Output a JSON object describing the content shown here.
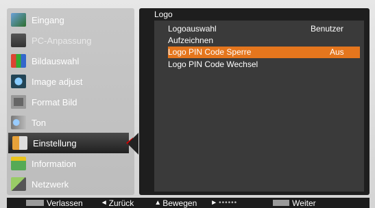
{
  "menu": {
    "items": [
      {
        "label": "Eingang",
        "icon": "input-icon",
        "disabled": false
      },
      {
        "label": "PC-Anpassung",
        "icon": "pc-adjust-icon",
        "disabled": true
      },
      {
        "label": "Bildauswahl",
        "icon": "image-select-icon",
        "disabled": false
      },
      {
        "label": "Image adjust",
        "icon": "image-adjust-icon",
        "disabled": false
      },
      {
        "label": "Format Bild",
        "icon": "screen-format-icon",
        "disabled": false
      },
      {
        "label": "Ton",
        "icon": "sound-icon",
        "disabled": false
      },
      {
        "label": "Einstellung",
        "icon": "setting-icon",
        "disabled": false,
        "selected": true
      },
      {
        "label": "Information",
        "icon": "information-icon",
        "disabled": false
      },
      {
        "label": "Netzwerk",
        "icon": "network-icon",
        "disabled": false
      }
    ]
  },
  "panel": {
    "title": "Logo",
    "rows": [
      {
        "label": "Logoauswahl",
        "value": "Benutzer"
      },
      {
        "label": "Aufzeichnen",
        "value": ""
      },
      {
        "label": "Logo PIN Code Sperre",
        "value": "Aus",
        "highlight": true
      },
      {
        "label": "Logo PIN Code Wechsel",
        "value": ""
      }
    ]
  },
  "footer": {
    "exit": "Verlassen",
    "back": "Zurück",
    "move": "Bewegen",
    "next": "Weiter"
  },
  "colors": {
    "highlight": "#e5761d",
    "selector_arrow": "#d80000"
  }
}
